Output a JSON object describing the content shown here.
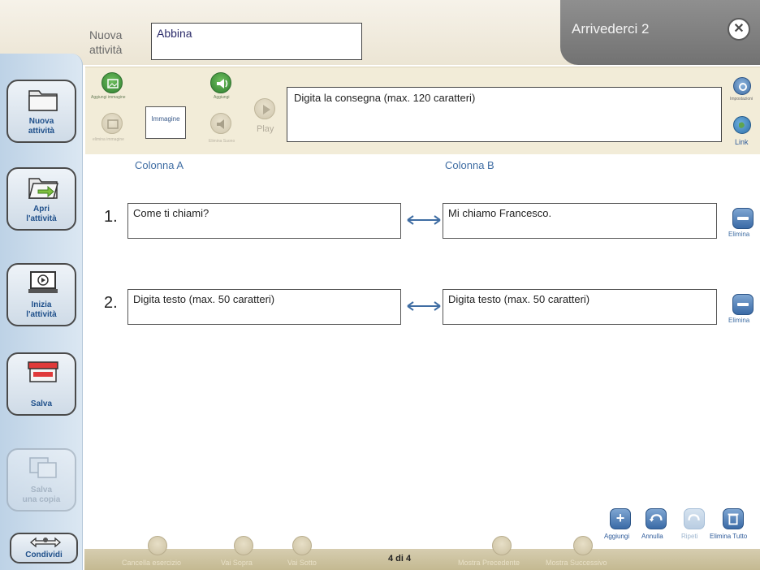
{
  "header": {
    "new_activity_label_1": "Nuova",
    "new_activity_label_2": "attività",
    "title_value": "Abbina",
    "window_title": "Arrivederci 2",
    "close_symbol": "✕"
  },
  "sidebar": {
    "items": [
      {
        "label_1": "Nuova",
        "label_2": "attività",
        "icon": "folder-icon"
      },
      {
        "label_1": "Apri",
        "label_2": "l'attività",
        "icon": "open-folder-icon"
      },
      {
        "label_1": "Inizia",
        "label_2": "l'attività",
        "icon": "play-screen-icon"
      },
      {
        "label_1": "Salva",
        "label_2": "",
        "icon": "save-box-icon"
      },
      {
        "label_1": "Salva",
        "label_2": "una copia",
        "icon": "save-copy-icon",
        "disabled": true
      }
    ],
    "share_label": "Condividi"
  },
  "toolbar": {
    "add_image_label": "Aggiungi immagine",
    "remove_image_label": "elimina immagine",
    "image_box_label": "Immagine",
    "add_sound_label": "Aggiungi",
    "remove_sound_label": "Elimina Suono",
    "play_label": "Play",
    "instruction_placeholder": "Digita  la consegna (max. 120 caratteri)",
    "settings_label": "Impostazioni",
    "link_label": "Link"
  },
  "columns": {
    "a_header": "Colonna A",
    "b_header": "Colonna B"
  },
  "rows": [
    {
      "number": "1.",
      "col_a": "Come ti chiami?",
      "col_b": "Mi chiamo Francesco.",
      "delete_label": "Elimina"
    },
    {
      "number": "2.",
      "col_a": "Digita testo (max. 50 caratteri)",
      "col_b": "Digita testo (max. 50 caratteri)",
      "delete_label": "Elimina"
    }
  ],
  "actions": {
    "add_label": "Aggiungi",
    "undo_label": "Annulla",
    "redo_label": "Ripeti",
    "delete_all_label": "Elimina Tutto"
  },
  "bottom": {
    "delete_exercise_label": "Cancella esercizio",
    "move_up_label": "Vai Sopra",
    "move_down_label": "Vai Sotto",
    "page_indicator": "4 di 4",
    "show_previous_label": "Mostra Precedente",
    "show_next_label": "Mostra Successivo"
  },
  "colors": {
    "sidebar_bg": "#c9dbec",
    "toolbar_bg": "#f2ecd8",
    "accent_blue": "#3f6da3",
    "header_dark": "#7f7f7f"
  }
}
